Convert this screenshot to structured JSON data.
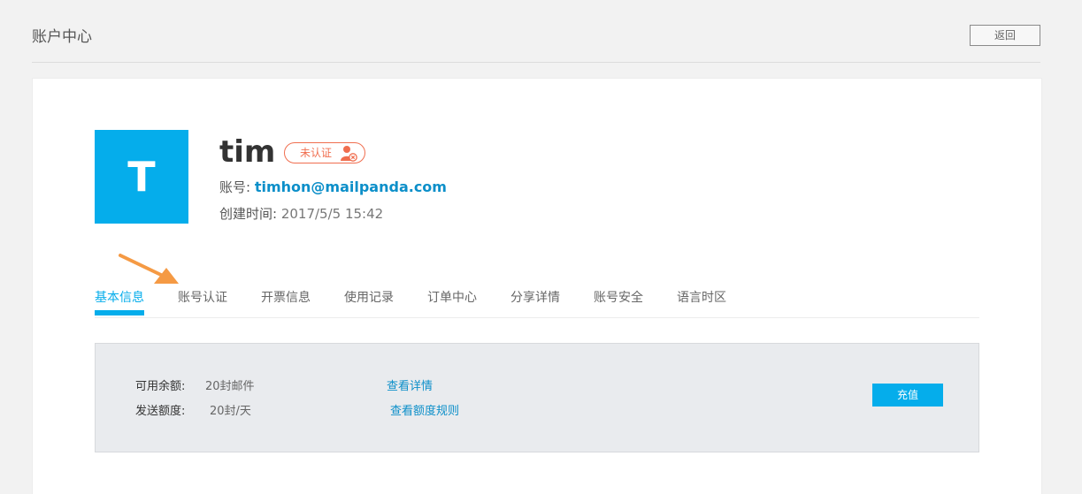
{
  "header": {
    "title": "账户中心",
    "back_label": "返回"
  },
  "profile": {
    "avatar_letter": "T",
    "username": "tim",
    "verify_status": "未认证",
    "account_label": "账号: ",
    "account_value": "timhon@mailpanda.com",
    "created_label": "创建时间: ",
    "created_value": "2017/5/5 15:42"
  },
  "tabs": [
    {
      "label": "基本信息",
      "active": true
    },
    {
      "label": "账号认证",
      "active": false
    },
    {
      "label": "开票信息",
      "active": false
    },
    {
      "label": "使用记录",
      "active": false
    },
    {
      "label": "订单中心",
      "active": false
    },
    {
      "label": "分享详情",
      "active": false
    },
    {
      "label": "账号安全",
      "active": false
    },
    {
      "label": "语言时区",
      "active": false
    }
  ],
  "quota": {
    "balance_label": "可用余额:",
    "balance_value": "20封邮件",
    "balance_link": "查看详情",
    "send_label": "发送额度:",
    "send_value": "20封/天",
    "send_link": "查看额度规则",
    "recharge_label": "充值"
  },
  "colors": {
    "accent": "#05adeb",
    "link": "#0c8fc9",
    "warning": "#f06e4f",
    "annotation_arrow": "#f59a44"
  },
  "icons": {
    "unverified_user": "user-x-icon",
    "annotation": "arrow-pointer-icon"
  }
}
